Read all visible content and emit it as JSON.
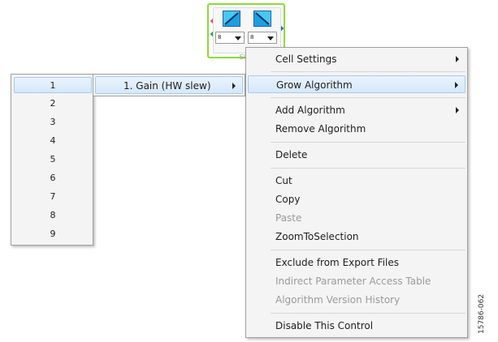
{
  "block": {
    "label": "Slew",
    "combo_left_value": "8",
    "combo_right_value": "8",
    "pin_colors": {
      "input_top": "#e0506a",
      "input_bottom": "#1aa64a",
      "output": "#1f5fd8"
    },
    "border_color": "#8fd93a"
  },
  "context_menu": {
    "items": [
      {
        "label": "Cell Settings",
        "submenu": true,
        "enabled": true
      },
      {
        "label": "Grow Algorithm",
        "submenu": true,
        "enabled": true,
        "highlighted": true
      },
      {
        "label": "Add Algorithm",
        "submenu": true,
        "enabled": true
      },
      {
        "label": "Remove Algorithm",
        "submenu": false,
        "enabled": true
      },
      {
        "label": "Delete",
        "submenu": false,
        "enabled": true
      },
      {
        "label": "Cut",
        "submenu": false,
        "enabled": true
      },
      {
        "label": "Copy",
        "submenu": false,
        "enabled": true
      },
      {
        "label": "Paste",
        "submenu": false,
        "enabled": false
      },
      {
        "label": "ZoomToSelection",
        "submenu": false,
        "enabled": true
      },
      {
        "label": "Exclude from Export Files",
        "submenu": false,
        "enabled": true
      },
      {
        "label": "Indirect Parameter Access Table",
        "submenu": false,
        "enabled": false
      },
      {
        "label": "Algorithm Version History",
        "submenu": false,
        "enabled": false
      },
      {
        "label": "Disable This Control",
        "submenu": false,
        "enabled": true
      }
    ]
  },
  "algorithm_submenu": {
    "items": [
      {
        "label": "1. Gain (HW slew)",
        "submenu": true,
        "highlighted": true
      }
    ]
  },
  "count_submenu": {
    "items": [
      "1",
      "2",
      "3",
      "4",
      "5",
      "6",
      "7",
      "8",
      "9"
    ],
    "highlighted_index": 0
  },
  "figure_id": "15786-062",
  "colors": {
    "menu_background": "#f4f4f4",
    "highlight": "#d6e8fb",
    "highlight_border": "#a9c9ee",
    "disabled_text": "#9a9a9a"
  }
}
